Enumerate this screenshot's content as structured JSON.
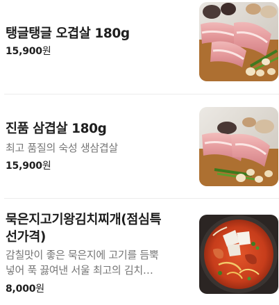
{
  "menu_items": [
    {
      "name": "탱글탱글 오겹살 180g",
      "description": "",
      "price": "15,900",
      "currency": "원",
      "image": "pork-belly-ogyeopsal-photo"
    },
    {
      "name": "진품 삼겹살 180g",
      "description": "최고 품질의 숙성 생삼겹살",
      "price": "15,900",
      "currency": "원",
      "image": "pork-belly-samgyeopsal-photo"
    },
    {
      "name_line1": "묵은지고기왕김치찌개(점심특",
      "name_line2": "선가격)",
      "description_line1": "감칠맛이 좋은 묵은지에 고기를 듬뿍",
      "description_line2": "넣어 푹 끓여낸 서울 최고의 김치…",
      "price": "8,000",
      "currency": "원",
      "image": "kimchi-stew-photo"
    }
  ]
}
